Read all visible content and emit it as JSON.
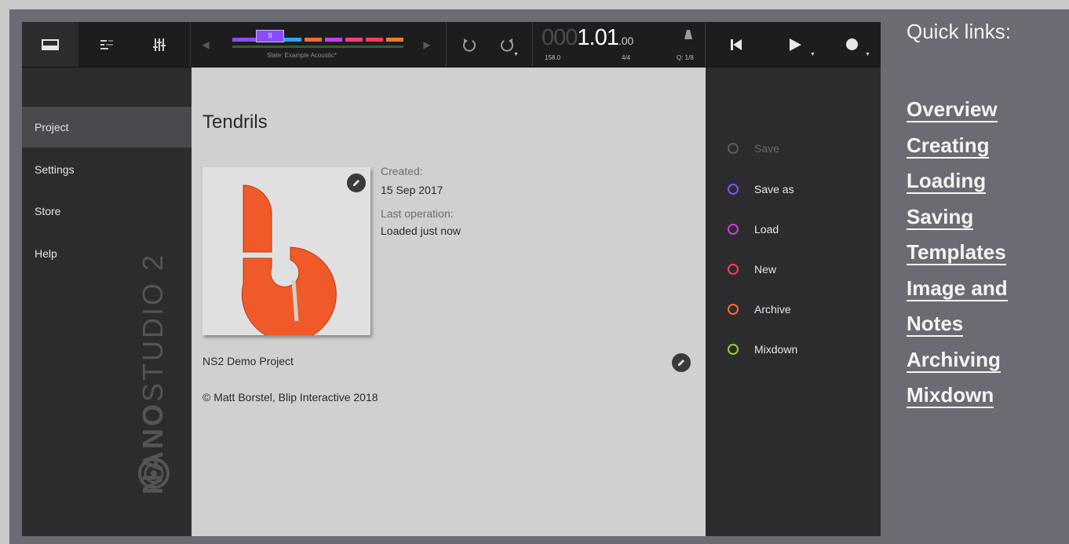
{
  "toolbar": {
    "icons": [
      "project-browser-icon",
      "tracks-icon",
      "mixer-icon"
    ],
    "slate_badge": "S",
    "slate_name": "Slate: Example Acoustic*",
    "time_prefix": "000",
    "time_main": "1.01",
    "time_sub": ".00",
    "tempo": "158.0",
    "signature": "4/4",
    "quantize": "Q: 1/8",
    "slate_colors": [
      "#8a4cff",
      "#2fa3ff",
      "#ff6b2e",
      "#c93cff",
      "#ff3d7a",
      "#ff3d5a",
      "#ff7a2e"
    ]
  },
  "sidebar": {
    "items": [
      {
        "label": "Project",
        "active": true
      },
      {
        "label": "Settings",
        "active": false
      },
      {
        "label": "Store",
        "active": false
      },
      {
        "label": "Help",
        "active": false
      }
    ],
    "brand_bold": "NANO",
    "brand_light": "STUDIO 2"
  },
  "project": {
    "title": "Tendrils",
    "created_label": "Created:",
    "created_value": "15 Sep 2017",
    "last_op_label": "Last operation:",
    "last_op_value": "Loaded just now",
    "description": "NS2 Demo Project",
    "copyright": "© Matt Borstel, Blip Interactive 2018",
    "logo_color": "#f05a28"
  },
  "actions": [
    {
      "label": "Save",
      "color": "#5a5a5e",
      "disabled": true
    },
    {
      "label": "Save as",
      "color": "#8a4cff",
      "disabled": false
    },
    {
      "label": "Load",
      "color": "#d23cd2",
      "disabled": false
    },
    {
      "label": "New",
      "color": "#ff3d5a",
      "disabled": false
    },
    {
      "label": "Archive",
      "color": "#ff6b2e",
      "disabled": false
    },
    {
      "label": "Mixdown",
      "color": "#9acd32",
      "disabled": false
    }
  ],
  "quick_links": {
    "title": "Quick links:",
    "links": [
      "Overview",
      "Creating",
      "Loading",
      "Saving",
      "Templates",
      "Image and",
      "Notes",
      "Archiving",
      "Mixdown"
    ]
  }
}
